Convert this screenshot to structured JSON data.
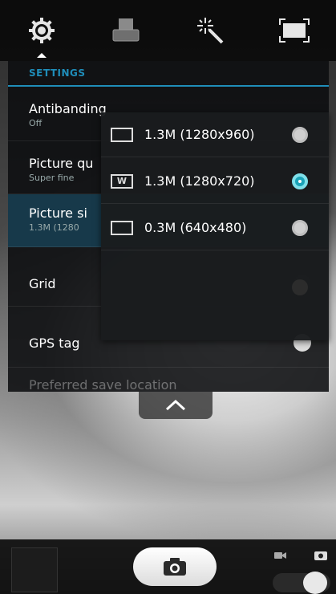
{
  "top_bar": {
    "icons": [
      {
        "name": "settings-gear-icon"
      },
      {
        "name": "auto-scene-icon",
        "label": "auto"
      },
      {
        "name": "magic-wand-effects-icon"
      },
      {
        "name": "fullscreen-frame-icon"
      }
    ]
  },
  "settings": {
    "header": "SETTINGS",
    "items": [
      {
        "title": "Antibanding",
        "subtitle": "Off"
      },
      {
        "title": "Picture qu",
        "subtitle": "Super fine"
      },
      {
        "title": "Picture si",
        "subtitle": "1.3M (1280"
      },
      {
        "title": "Grid",
        "subtitle": ""
      },
      {
        "title": "GPS tag",
        "subtitle": ""
      },
      {
        "title": "Preferred save location",
        "subtitle": ""
      }
    ]
  },
  "picture_size_popup": {
    "options": [
      {
        "icon_badge": "",
        "label": "1.3M (1280x960)",
        "selected": false
      },
      {
        "icon_badge": "W",
        "label": "1.3M (1280x720)",
        "selected": true
      },
      {
        "icon_badge": "",
        "label": "0.3M (640x480)",
        "selected": false
      }
    ]
  },
  "colors": {
    "accent": "#1f8db9",
    "selected_radio": "#1aa3b8",
    "selected_row": "#17394a"
  }
}
